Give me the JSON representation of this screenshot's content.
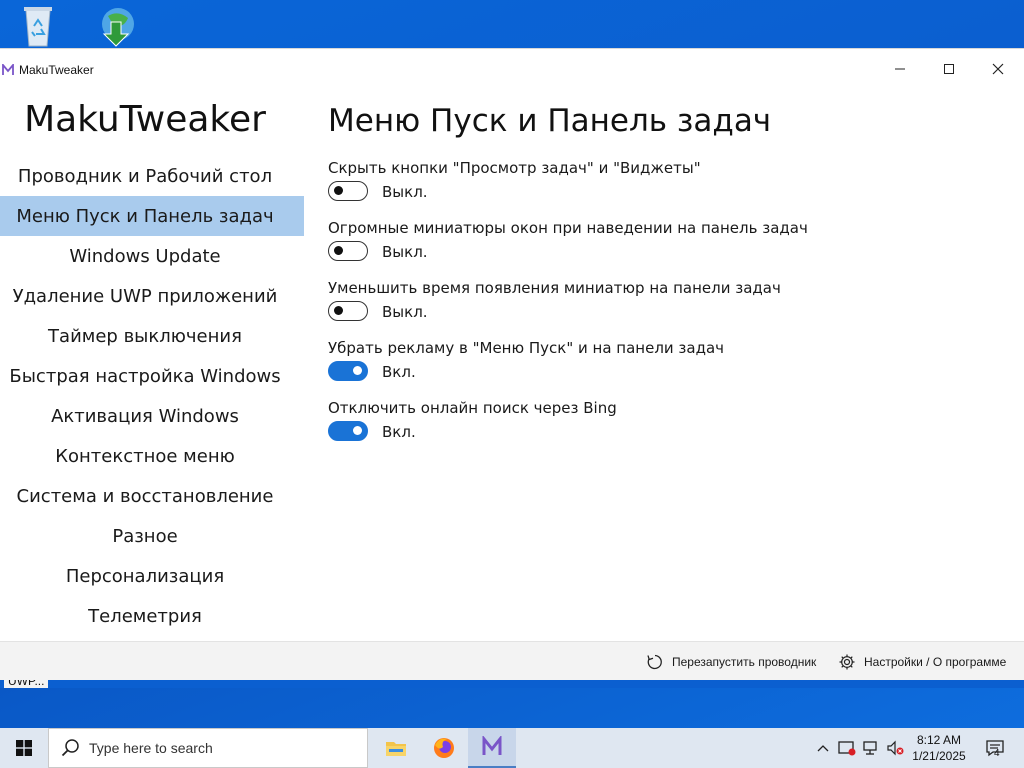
{
  "window": {
    "title": "MakuTweaker"
  },
  "sidebar": {
    "brand": "MakuTweaker",
    "items": [
      {
        "label": "Проводник и Рабочий стол",
        "active": false
      },
      {
        "label": "Меню Пуск и Панель задач",
        "active": true
      },
      {
        "label": "Windows Update",
        "active": false
      },
      {
        "label": "Удаление UWP приложений",
        "active": false
      },
      {
        "label": "Таймер выключения",
        "active": false
      },
      {
        "label": "Быстрая настройка Windows",
        "active": false
      },
      {
        "label": "Активация Windows",
        "active": false
      },
      {
        "label": "Контекстное меню",
        "active": false
      },
      {
        "label": "Система и восстановление",
        "active": false
      },
      {
        "label": "Разное",
        "active": false
      },
      {
        "label": "Персонализация",
        "active": false
      },
      {
        "label": "Телеметрия",
        "active": false
      }
    ]
  },
  "main": {
    "title": "Меню Пуск и Панель задач",
    "settings": [
      {
        "label": "Скрыть кнопки \"Просмотр задач\" и \"Виджеты\"",
        "on": false,
        "state": "Выкл."
      },
      {
        "label": "Огромные миниатюры окон при наведении на панель задач",
        "on": false,
        "state": "Выкл."
      },
      {
        "label": "Уменьшить время появления миниатюр на панели задач",
        "on": false,
        "state": "Выкл."
      },
      {
        "label": "Убрать рекламу в \"Меню Пуск\" и на панели задач",
        "on": true,
        "state": "Вкл."
      },
      {
        "label": "Отключить онлайн поиск через Bing",
        "on": true,
        "state": "Вкл."
      }
    ]
  },
  "footer": {
    "restart_label": "Перезапустить проводник",
    "about_label": "Настройки / О программе"
  },
  "status_strip": {
    "text": "UWP..."
  },
  "taskbar": {
    "search_placeholder": "Type here to search",
    "time": "8:12 AM",
    "date": "1/21/2025",
    "notification_count": "4"
  },
  "colors": {
    "accent": "#1a73d6",
    "active_nav": "#a9cbed",
    "desktop": "#0a66d8"
  }
}
